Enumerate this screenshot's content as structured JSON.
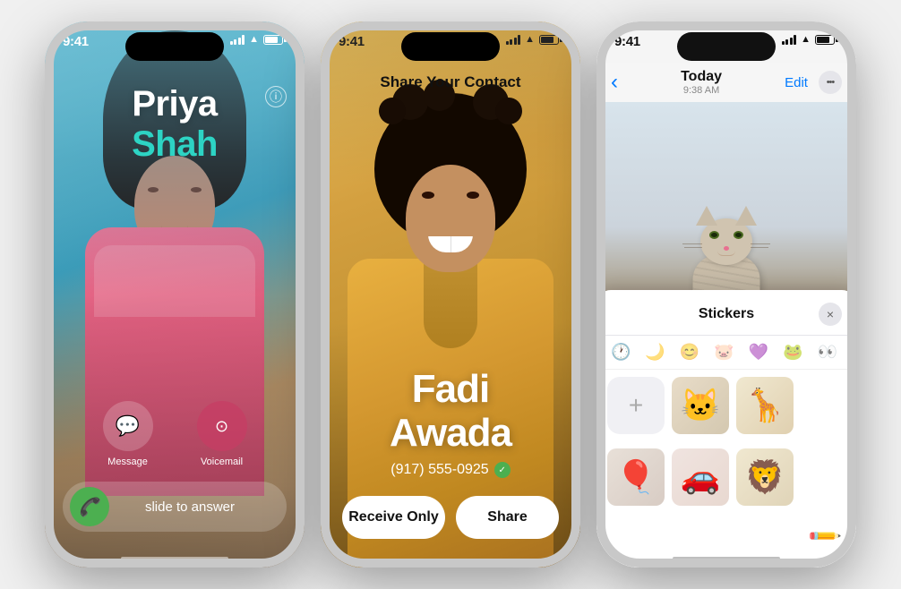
{
  "phones": {
    "phone1": {
      "statusTime": "9:41",
      "contactFirstName": "Priya",
      "contactLastName": "Shah",
      "infoButton": "ⓘ",
      "messageLabel": "Message",
      "voicemailLabel": "Voicemail",
      "slideText": "slide to answer",
      "messageIcon": "💬",
      "voicemailIcon": "⊙"
    },
    "phone2": {
      "statusTime": "9:41",
      "shareTitle": "Share Your Contact",
      "contactName": "Fadi\nAwada",
      "contactNameLine1": "Fadi",
      "contactNameLine2": "Awada",
      "phoneNumber": "(917) 555-0925",
      "receiveOnlyLabel": "Receive Only",
      "shareLabel": "Share"
    },
    "phone3": {
      "statusTime": "9:41",
      "navBackIcon": "‹",
      "conversationDate": "Today",
      "conversationTime": "9:38 AM",
      "editLabel": "Edit",
      "moreIcon": "•••",
      "stickerPanelTitle": "Stickers",
      "closeIcon": "×",
      "tabIcons": [
        "🕐",
        "🌙",
        "😊",
        "🐷",
        "💜",
        "🐸",
        "👀"
      ]
    }
  }
}
